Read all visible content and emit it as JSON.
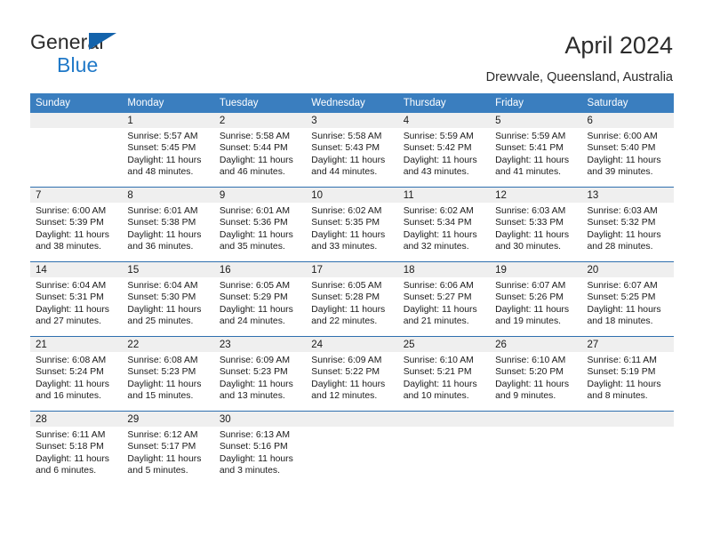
{
  "brand": {
    "name_part1": "General",
    "name_part2": "Blue",
    "accent_color": "#2079c8",
    "triangle_color": "#1463ab"
  },
  "header": {
    "title": "April 2024",
    "subtitle": "Drewvale, Queensland, Australia"
  },
  "calendar": {
    "header_bg": "#3a7ebf",
    "week_separator_color": "#2f6fae",
    "daynum_band_color": "#efefef",
    "weekday_headers": [
      "Sunday",
      "Monday",
      "Tuesday",
      "Wednesday",
      "Thursday",
      "Friday",
      "Saturday"
    ],
    "weeks": [
      [
        {
          "day": "",
          "sunrise": "",
          "sunset": "",
          "daylight1": "",
          "daylight2": ""
        },
        {
          "day": "1",
          "sunrise": "Sunrise: 5:57 AM",
          "sunset": "Sunset: 5:45 PM",
          "daylight1": "Daylight: 11 hours",
          "daylight2": "and 48 minutes."
        },
        {
          "day": "2",
          "sunrise": "Sunrise: 5:58 AM",
          "sunset": "Sunset: 5:44 PM",
          "daylight1": "Daylight: 11 hours",
          "daylight2": "and 46 minutes."
        },
        {
          "day": "3",
          "sunrise": "Sunrise: 5:58 AM",
          "sunset": "Sunset: 5:43 PM",
          "daylight1": "Daylight: 11 hours",
          "daylight2": "and 44 minutes."
        },
        {
          "day": "4",
          "sunrise": "Sunrise: 5:59 AM",
          "sunset": "Sunset: 5:42 PM",
          "daylight1": "Daylight: 11 hours",
          "daylight2": "and 43 minutes."
        },
        {
          "day": "5",
          "sunrise": "Sunrise: 5:59 AM",
          "sunset": "Sunset: 5:41 PM",
          "daylight1": "Daylight: 11 hours",
          "daylight2": "and 41 minutes."
        },
        {
          "day": "6",
          "sunrise": "Sunrise: 6:00 AM",
          "sunset": "Sunset: 5:40 PM",
          "daylight1": "Daylight: 11 hours",
          "daylight2": "and 39 minutes."
        }
      ],
      [
        {
          "day": "7",
          "sunrise": "Sunrise: 6:00 AM",
          "sunset": "Sunset: 5:39 PM",
          "daylight1": "Daylight: 11 hours",
          "daylight2": "and 38 minutes."
        },
        {
          "day": "8",
          "sunrise": "Sunrise: 6:01 AM",
          "sunset": "Sunset: 5:38 PM",
          "daylight1": "Daylight: 11 hours",
          "daylight2": "and 36 minutes."
        },
        {
          "day": "9",
          "sunrise": "Sunrise: 6:01 AM",
          "sunset": "Sunset: 5:36 PM",
          "daylight1": "Daylight: 11 hours",
          "daylight2": "and 35 minutes."
        },
        {
          "day": "10",
          "sunrise": "Sunrise: 6:02 AM",
          "sunset": "Sunset: 5:35 PM",
          "daylight1": "Daylight: 11 hours",
          "daylight2": "and 33 minutes."
        },
        {
          "day": "11",
          "sunrise": "Sunrise: 6:02 AM",
          "sunset": "Sunset: 5:34 PM",
          "daylight1": "Daylight: 11 hours",
          "daylight2": "and 32 minutes."
        },
        {
          "day": "12",
          "sunrise": "Sunrise: 6:03 AM",
          "sunset": "Sunset: 5:33 PM",
          "daylight1": "Daylight: 11 hours",
          "daylight2": "and 30 minutes."
        },
        {
          "day": "13",
          "sunrise": "Sunrise: 6:03 AM",
          "sunset": "Sunset: 5:32 PM",
          "daylight1": "Daylight: 11 hours",
          "daylight2": "and 28 minutes."
        }
      ],
      [
        {
          "day": "14",
          "sunrise": "Sunrise: 6:04 AM",
          "sunset": "Sunset: 5:31 PM",
          "daylight1": "Daylight: 11 hours",
          "daylight2": "and 27 minutes."
        },
        {
          "day": "15",
          "sunrise": "Sunrise: 6:04 AM",
          "sunset": "Sunset: 5:30 PM",
          "daylight1": "Daylight: 11 hours",
          "daylight2": "and 25 minutes."
        },
        {
          "day": "16",
          "sunrise": "Sunrise: 6:05 AM",
          "sunset": "Sunset: 5:29 PM",
          "daylight1": "Daylight: 11 hours",
          "daylight2": "and 24 minutes."
        },
        {
          "day": "17",
          "sunrise": "Sunrise: 6:05 AM",
          "sunset": "Sunset: 5:28 PM",
          "daylight1": "Daylight: 11 hours",
          "daylight2": "and 22 minutes."
        },
        {
          "day": "18",
          "sunrise": "Sunrise: 6:06 AM",
          "sunset": "Sunset: 5:27 PM",
          "daylight1": "Daylight: 11 hours",
          "daylight2": "and 21 minutes."
        },
        {
          "day": "19",
          "sunrise": "Sunrise: 6:07 AM",
          "sunset": "Sunset: 5:26 PM",
          "daylight1": "Daylight: 11 hours",
          "daylight2": "and 19 minutes."
        },
        {
          "day": "20",
          "sunrise": "Sunrise: 6:07 AM",
          "sunset": "Sunset: 5:25 PM",
          "daylight1": "Daylight: 11 hours",
          "daylight2": "and 18 minutes."
        }
      ],
      [
        {
          "day": "21",
          "sunrise": "Sunrise: 6:08 AM",
          "sunset": "Sunset: 5:24 PM",
          "daylight1": "Daylight: 11 hours",
          "daylight2": "and 16 minutes."
        },
        {
          "day": "22",
          "sunrise": "Sunrise: 6:08 AM",
          "sunset": "Sunset: 5:23 PM",
          "daylight1": "Daylight: 11 hours",
          "daylight2": "and 15 minutes."
        },
        {
          "day": "23",
          "sunrise": "Sunrise: 6:09 AM",
          "sunset": "Sunset: 5:23 PM",
          "daylight1": "Daylight: 11 hours",
          "daylight2": "and 13 minutes."
        },
        {
          "day": "24",
          "sunrise": "Sunrise: 6:09 AM",
          "sunset": "Sunset: 5:22 PM",
          "daylight1": "Daylight: 11 hours",
          "daylight2": "and 12 minutes."
        },
        {
          "day": "25",
          "sunrise": "Sunrise: 6:10 AM",
          "sunset": "Sunset: 5:21 PM",
          "daylight1": "Daylight: 11 hours",
          "daylight2": "and 10 minutes."
        },
        {
          "day": "26",
          "sunrise": "Sunrise: 6:10 AM",
          "sunset": "Sunset: 5:20 PM",
          "daylight1": "Daylight: 11 hours",
          "daylight2": "and 9 minutes."
        },
        {
          "day": "27",
          "sunrise": "Sunrise: 6:11 AM",
          "sunset": "Sunset: 5:19 PM",
          "daylight1": "Daylight: 11 hours",
          "daylight2": "and 8 minutes."
        }
      ],
      [
        {
          "day": "28",
          "sunrise": "Sunrise: 6:11 AM",
          "sunset": "Sunset: 5:18 PM",
          "daylight1": "Daylight: 11 hours",
          "daylight2": "and 6 minutes."
        },
        {
          "day": "29",
          "sunrise": "Sunrise: 6:12 AM",
          "sunset": "Sunset: 5:17 PM",
          "daylight1": "Daylight: 11 hours",
          "daylight2": "and 5 minutes."
        },
        {
          "day": "30",
          "sunrise": "Sunrise: 6:13 AM",
          "sunset": "Sunset: 5:16 PM",
          "daylight1": "Daylight: 11 hours",
          "daylight2": "and 3 minutes."
        },
        {
          "day": "",
          "sunrise": "",
          "sunset": "",
          "daylight1": "",
          "daylight2": ""
        },
        {
          "day": "",
          "sunrise": "",
          "sunset": "",
          "daylight1": "",
          "daylight2": ""
        },
        {
          "day": "",
          "sunrise": "",
          "sunset": "",
          "daylight1": "",
          "daylight2": ""
        },
        {
          "day": "",
          "sunrise": "",
          "sunset": "",
          "daylight1": "",
          "daylight2": ""
        }
      ]
    ]
  }
}
